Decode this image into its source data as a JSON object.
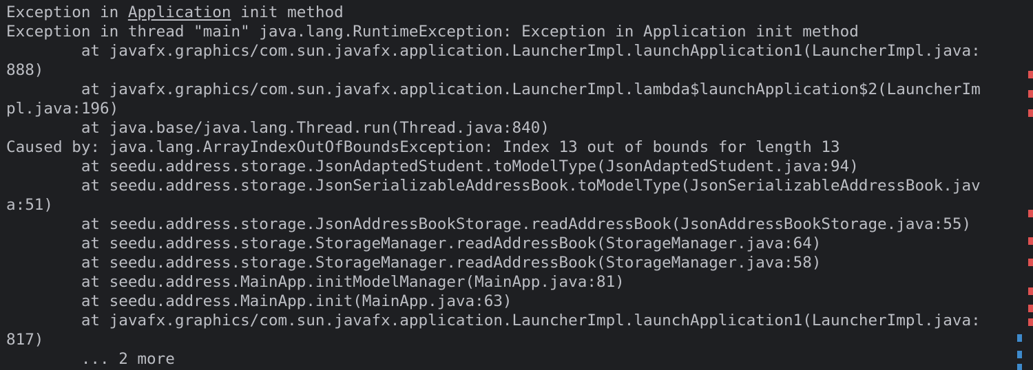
{
  "console": {
    "lines": [
      {
        "pre": "Exception in ",
        "link": "Application",
        "post": " init method"
      },
      {
        "text": "Exception in thread \"main\" java.lang.RuntimeException: Exception in Application init method"
      },
      {
        "text": "        at javafx.graphics/com.sun.javafx.application.LauncherImpl.launchApplication1(LauncherImpl.java:"
      },
      {
        "text": "888)"
      },
      {
        "text": "        at javafx.graphics/com.sun.javafx.application.LauncherImpl.lambda$launchApplication$2(LauncherIm"
      },
      {
        "text": "pl.java:196)"
      },
      {
        "text": "        at java.base/java.lang.Thread.run(Thread.java:840)"
      },
      {
        "text": "Caused by: java.lang.ArrayIndexOutOfBoundsException: Index 13 out of bounds for length 13"
      },
      {
        "text": "        at seedu.address.storage.JsonAdaptedStudent.toModelType(JsonAdaptedStudent.java:94)"
      },
      {
        "text": "        at seedu.address.storage.JsonSerializableAddressBook.toModelType(JsonSerializableAddressBook.jav"
      },
      {
        "text": "a:51)"
      },
      {
        "text": "        at seedu.address.storage.JsonAddressBookStorage.readAddressBook(JsonAddressBookStorage.java:55)"
      },
      {
        "text": "        at seedu.address.storage.StorageManager.readAddressBook(StorageManager.java:64)"
      },
      {
        "text": "        at seedu.address.storage.StorageManager.readAddressBook(StorageManager.java:58)"
      },
      {
        "text": "        at seedu.address.MainApp.initModelManager(MainApp.java:81)"
      },
      {
        "text": "        at seedu.address.MainApp.init(MainApp.java:63)"
      },
      {
        "text": "        at javafx.graphics/com.sun.javafx.application.LauncherImpl.launchApplication1(LauncherImpl.java:"
      },
      {
        "text": "817)"
      },
      {
        "text": "        ... 2 more"
      }
    ]
  },
  "colors": {
    "background": "#1e1f22",
    "text": "#bcbec4",
    "error_marker": "#e05252",
    "info_marker": "#3e8acc"
  }
}
